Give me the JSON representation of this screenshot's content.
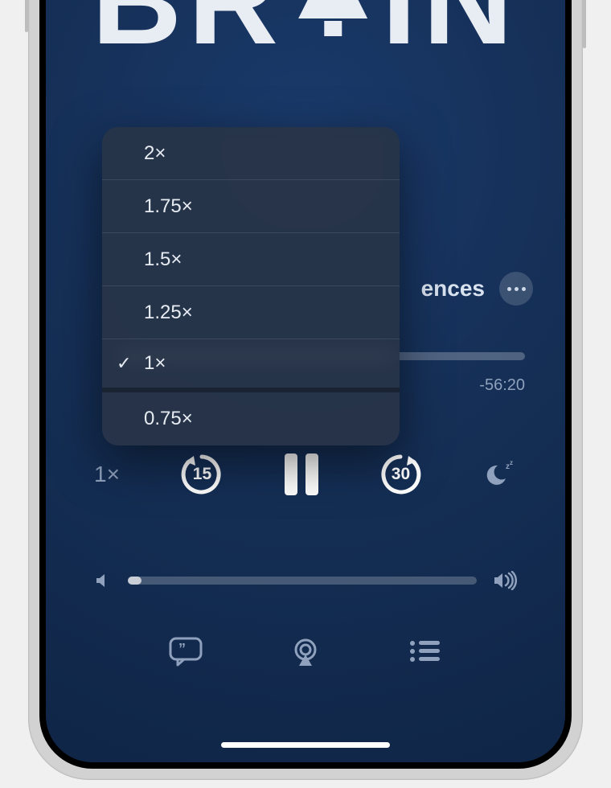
{
  "artwork": {
    "word": "BRAIN"
  },
  "title": {
    "visible_fragment": "ences"
  },
  "colors": {
    "background": "#132a4f",
    "muted": "#8fa1bc",
    "menu_bg": "#2a3547"
  },
  "playback": {
    "time_remaining": "-56:20",
    "progress_percent": 66,
    "speed_label": "1×",
    "skip_back_seconds": "15",
    "skip_forward_seconds": "30",
    "volume_percent": 4
  },
  "speed_menu": {
    "options": [
      "2×",
      "1.75×",
      "1.5×",
      "1.25×",
      "1×",
      "0.75×"
    ],
    "selected_index": 4
  },
  "icons": {
    "more": "more-icon",
    "skip_back": "skip-back-15-icon",
    "skip_forward": "skip-forward-30-icon",
    "pause": "pause-icon",
    "sleep": "sleep-timer-icon",
    "vol_low": "volume-low-icon",
    "vol_high": "volume-high-icon",
    "transcript": "transcript-icon",
    "airplay": "airplay-icon",
    "queue": "queue-icon"
  }
}
